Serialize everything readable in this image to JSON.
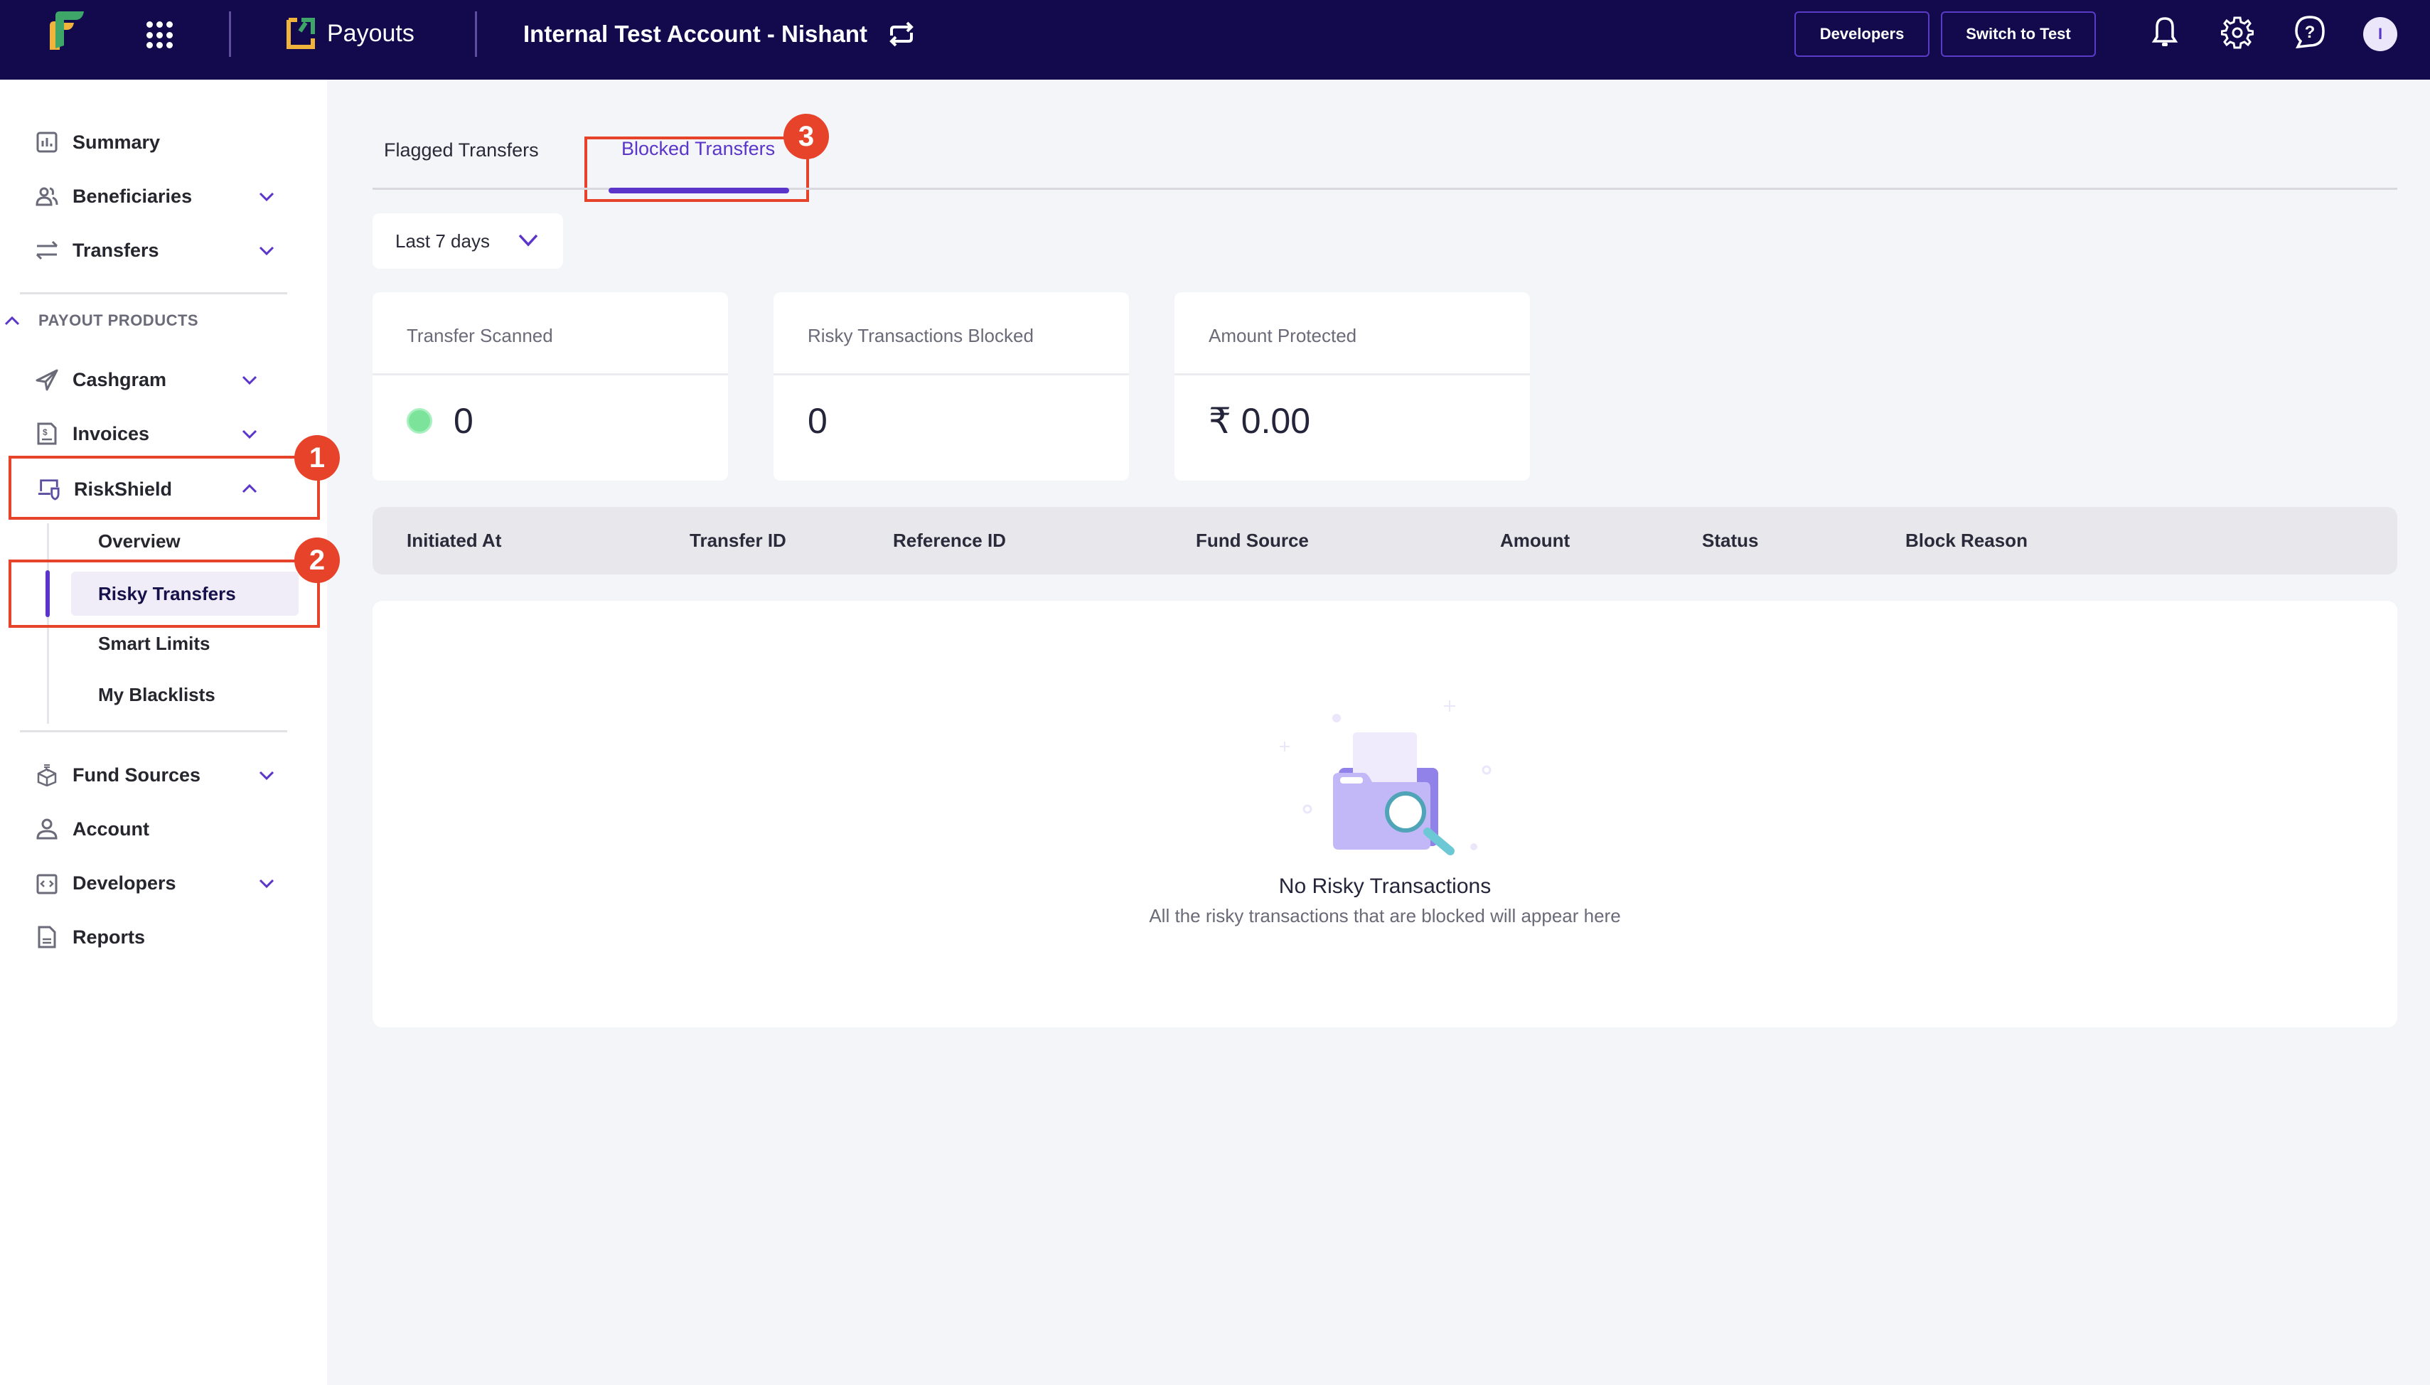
{
  "header": {
    "product_name": "Payouts",
    "account_name": "Internal Test Account - Nishant",
    "developers_label": "Developers",
    "switch_label": "Switch to Test",
    "avatar_initial": "I"
  },
  "sidebar": {
    "top_items": [
      {
        "label": "Summary",
        "icon": "bar-chart-icon",
        "expandable": false
      },
      {
        "label": "Beneficiaries",
        "icon": "users-icon",
        "expandable": true
      },
      {
        "label": "Transfers",
        "icon": "arrows-swap-icon",
        "expandable": true
      }
    ],
    "section_label": "PAYOUT PRODUCTS",
    "product_items": [
      {
        "label": "Cashgram",
        "icon": "paper-plane-icon",
        "expandable": true
      },
      {
        "label": "Invoices",
        "icon": "invoice-icon",
        "expandable": true
      },
      {
        "label": "RiskShield",
        "icon": "shield-laptop-icon",
        "expanded": true
      }
    ],
    "riskshield_sub": [
      {
        "label": "Overview",
        "active": false
      },
      {
        "label": "Risky Transfers",
        "active": true
      },
      {
        "label": "Smart Limits",
        "active": false
      },
      {
        "label": "My Blacklists",
        "active": false
      }
    ],
    "bottom_items": [
      {
        "label": "Fund Sources",
        "icon": "fund-box-icon",
        "expandable": true
      },
      {
        "label": "Account",
        "icon": "user-icon",
        "expandable": false
      },
      {
        "label": "Developers",
        "icon": "code-icon",
        "expandable": true
      },
      {
        "label": "Reports",
        "icon": "document-icon",
        "expandable": false
      }
    ]
  },
  "annotations": [
    "1",
    "2",
    "3"
  ],
  "tabs": [
    {
      "label": "Flagged Transfers",
      "active": false
    },
    {
      "label": "Blocked Transfers",
      "active": true
    }
  ],
  "filter": {
    "date_range": "Last 7 days"
  },
  "stats": [
    {
      "title": "Transfer Scanned",
      "value": "0",
      "indicator": "green"
    },
    {
      "title": "Risky Transactions Blocked",
      "value": "0"
    },
    {
      "title": "Amount Protected",
      "value": "₹ 0.00"
    }
  ],
  "table": {
    "columns": [
      "Initiated At",
      "Transfer ID",
      "Reference ID",
      "Fund Source",
      "Amount",
      "Status",
      "Block Reason"
    ],
    "rows": []
  },
  "empty_state": {
    "title": "No Risky Transactions",
    "subtitle": "All the risky transactions that are blocked will appear here"
  },
  "colors": {
    "header_bg": "#130a4e",
    "accent": "#5b35c9",
    "annotation": "#e6432a",
    "success": "#7be39a"
  }
}
